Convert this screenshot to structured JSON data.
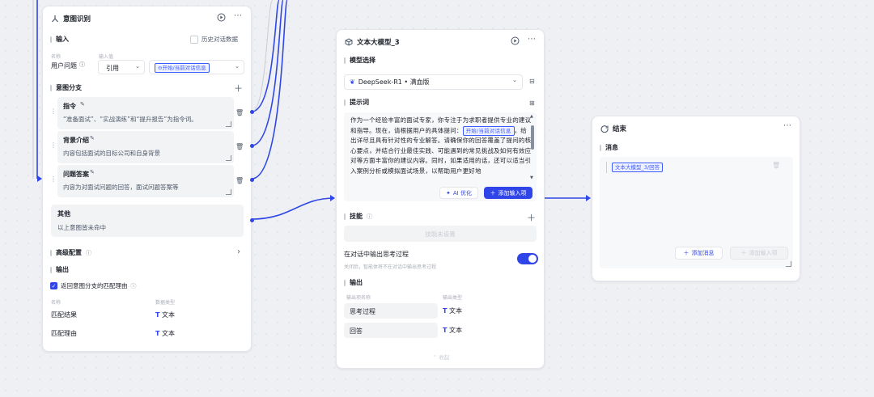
{
  "intent_node": {
    "title": "意图识别",
    "input_label": "输入",
    "history_label": "历史对话数据",
    "col_name": "名称",
    "col_value": "输入值",
    "param_name": "用户问题",
    "ref_mode": "引用",
    "ref_tag": "开始/当前对话信息",
    "branches_label": "意图分支",
    "branches": [
      {
        "name": "指令",
        "desc": "“准备面试”、“实战演练”和“提升报告”为指令词。"
      },
      {
        "name": "背景介绍",
        "desc": "内容包括面试的目标公司和自身背景"
      },
      {
        "name": "问题答案",
        "desc": "内容为对面试问题的回答，面试问题答案等"
      }
    ],
    "other_label": "其他",
    "other_desc": "以上意图皆未命中",
    "advanced_label": "高级配置",
    "output_label": "输出",
    "return_reason_label": "返回意图分支的匹配理由",
    "out_col_name": "名称",
    "out_col_type": "数据类型",
    "outputs": [
      {
        "name": "匹配结果",
        "type": "文本"
      },
      {
        "name": "匹配理由",
        "type": "文本"
      }
    ]
  },
  "llm_node": {
    "title": "文本大模型_3",
    "model_label": "模型选择",
    "model_name": "DeepSeek-R1 • 满血版",
    "prompt_label": "提示词",
    "prompt_text_1": "作为一个经验丰富的面试专家，你专注于为求职者提供专业的建议和指导。现在，请根据用户的具体提问：",
    "prompt_tag": "开始/当前对话信息",
    "prompt_text_2": "，给出详尽且具有针对性的专业解答。请确保你的回答覆盖了提问的核心要点，并结合行业最佳实践、可能遇到的常见挑战及如何有效应对等方面丰富你的建议内容。同时，如果适用的话，还可以适当引入案例分析或模拟面试场景，以帮助用户更好地",
    "ai_optimize": "AI 优化",
    "add_input": "添加输入项",
    "skills_label": "技能",
    "skills_empty": "技能未设置",
    "thinking_label": "在对话中输出思考过程",
    "thinking_desc": "关闭后，智能体将不在对话中输出思考过程",
    "output_label": "输出",
    "out_col_name": "输出项名称",
    "out_col_type": "输出类型",
    "outputs": [
      {
        "name": "思考过程",
        "type": "文本"
      },
      {
        "name": "回答",
        "type": "文本"
      }
    ],
    "collapse": "收起"
  },
  "end_node": {
    "title": "结束",
    "message_label": "消息",
    "message_tag": "文本大模型_3/回答",
    "add_message": "添加消息",
    "add_input": "添加输入项"
  },
  "colors": {
    "accent": "#3045e8",
    "wire": "#2f47e6"
  }
}
